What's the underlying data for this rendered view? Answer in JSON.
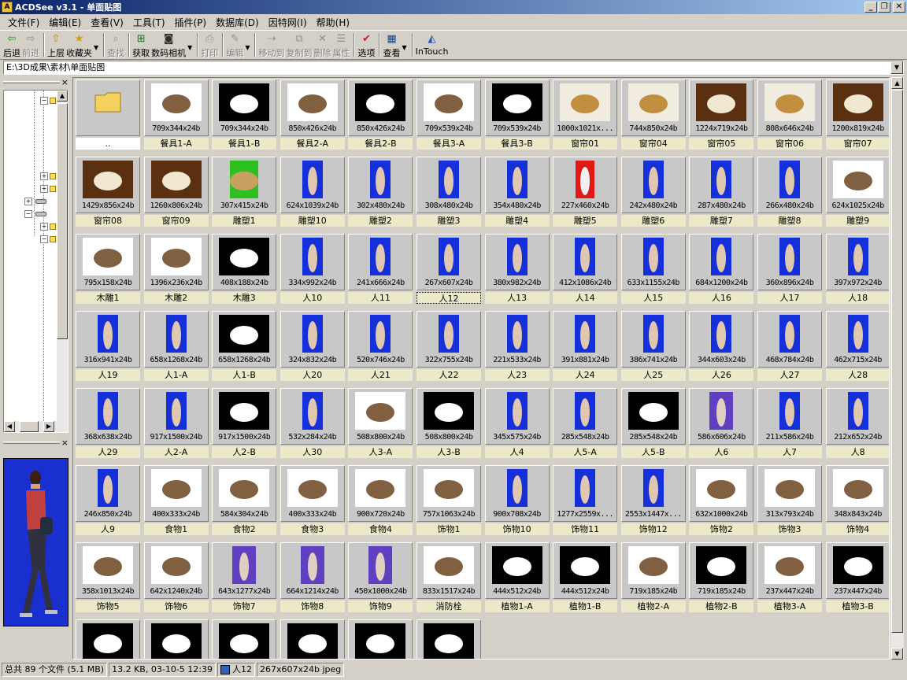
{
  "window": {
    "title": "ACDSee v3.1 - 单面贴图"
  },
  "menu": [
    "文件(F)",
    "编辑(E)",
    "查看(V)",
    "工具(T)",
    "插件(P)",
    "数据库(D)",
    "因特网(I)",
    "帮助(H)"
  ],
  "toolbar": [
    {
      "label": "后退",
      "icon": "back-icon",
      "enabled": true
    },
    {
      "label": "前进",
      "icon": "forward-icon",
      "enabled": false
    },
    {
      "label": "上层",
      "icon": "up-folder-icon",
      "enabled": true
    },
    {
      "label": "收藏夹",
      "icon": "favorites-icon",
      "enabled": true
    },
    {
      "label": "查找",
      "icon": "find-icon",
      "enabled": false
    },
    {
      "label": "获取",
      "icon": "acquire-icon",
      "enabled": true
    },
    {
      "label": "数码相机",
      "icon": "camera-icon",
      "enabled": true
    },
    {
      "label": "打印",
      "icon": "print-icon",
      "enabled": false
    },
    {
      "label": "编辑",
      "icon": "edit-icon",
      "enabled": false
    },
    {
      "label": "移动到",
      "icon": "move-icon",
      "enabled": false
    },
    {
      "label": "复制到",
      "icon": "copy-icon",
      "enabled": false
    },
    {
      "label": "删除",
      "icon": "delete-icon",
      "enabled": false
    },
    {
      "label": "属性",
      "icon": "properties-icon",
      "enabled": false
    },
    {
      "label": "选项",
      "icon": "options-icon",
      "enabled": true
    },
    {
      "label": "查看",
      "icon": "view-icon",
      "enabled": true
    },
    {
      "label": "InTouch",
      "icon": "intouch-icon",
      "enabled": true
    }
  ],
  "address": "E:\\3D成果\\素材\\单面贴图",
  "files": [
    {
      "name": "..",
      "dims": "",
      "kind": "folder"
    },
    {
      "name": "餐具1-A",
      "dims": "709x344x24b",
      "kind": "white"
    },
    {
      "name": "餐具1-B",
      "dims": "709x344x24b",
      "kind": "black"
    },
    {
      "name": "餐具2-A",
      "dims": "850x426x24b",
      "kind": "white"
    },
    {
      "name": "餐具2-B",
      "dims": "850x426x24b",
      "kind": "black"
    },
    {
      "name": "餐具3-A",
      "dims": "709x539x24b",
      "kind": "white"
    },
    {
      "name": "餐具3-B",
      "dims": "709x539x24b",
      "kind": "black"
    },
    {
      "name": "窗帘01",
      "dims": "1000x1021x...",
      "kind": "cream"
    },
    {
      "name": "窗帘04",
      "dims": "744x850x24b",
      "kind": "cream"
    },
    {
      "name": "窗帘05",
      "dims": "1224x719x24b",
      "kind": "brown"
    },
    {
      "name": "窗帘06",
      "dims": "808x646x24b",
      "kind": "cream"
    },
    {
      "name": "窗帘07",
      "dims": "1200x819x24b",
      "kind": "brown"
    },
    {
      "name": "窗帘08",
      "dims": "1429x856x24b",
      "kind": "brown"
    },
    {
      "name": "窗帘09",
      "dims": "1260x806x24b",
      "kind": "brown"
    },
    {
      "name": "雕塑1",
      "dims": "307x415x24b",
      "kind": "green"
    },
    {
      "name": "雕塑10",
      "dims": "624x1039x24b",
      "kind": "blue"
    },
    {
      "name": "雕塑2",
      "dims": "302x480x24b",
      "kind": "blue"
    },
    {
      "name": "雕塑3",
      "dims": "308x480x24b",
      "kind": "blue"
    },
    {
      "name": "雕塑4",
      "dims": "354x480x24b",
      "kind": "blue"
    },
    {
      "name": "雕塑5",
      "dims": "227x460x24b",
      "kind": "red"
    },
    {
      "name": "雕塑6",
      "dims": "242x480x24b",
      "kind": "blue"
    },
    {
      "name": "雕塑7",
      "dims": "287x480x24b",
      "kind": "blue"
    },
    {
      "name": "雕塑8",
      "dims": "266x480x24b",
      "kind": "blue"
    },
    {
      "name": "雕塑9",
      "dims": "624x1025x24b",
      "kind": "white"
    },
    {
      "name": "木雕1",
      "dims": "795x158x24b",
      "kind": "white"
    },
    {
      "name": "木雕2",
      "dims": "1396x236x24b",
      "kind": "white"
    },
    {
      "name": "木雕3",
      "dims": "408x188x24b",
      "kind": "black"
    },
    {
      "name": "人10",
      "dims": "334x992x24b",
      "kind": "blue"
    },
    {
      "name": "人11",
      "dims": "241x666x24b",
      "kind": "blue"
    },
    {
      "name": "人12",
      "dims": "267x607x24b",
      "kind": "blue"
    },
    {
      "name": "人13",
      "dims": "380x982x24b",
      "kind": "blue"
    },
    {
      "name": "人14",
      "dims": "412x1086x24b",
      "kind": "blue"
    },
    {
      "name": "人15",
      "dims": "633x1155x24b",
      "kind": "blue"
    },
    {
      "name": "人16",
      "dims": "684x1200x24b",
      "kind": "blue"
    },
    {
      "name": "人17",
      "dims": "360x896x24b",
      "kind": "blue"
    },
    {
      "name": "人18",
      "dims": "397x972x24b",
      "kind": "blue"
    },
    {
      "name": "人19",
      "dims": "316x941x24b",
      "kind": "blue"
    },
    {
      "name": "人1-A",
      "dims": "658x1268x24b",
      "kind": "blue"
    },
    {
      "name": "人1-B",
      "dims": "658x1268x24b",
      "kind": "black"
    },
    {
      "name": "人20",
      "dims": "324x832x24b",
      "kind": "blue"
    },
    {
      "name": "人21",
      "dims": "520x746x24b",
      "kind": "blue"
    },
    {
      "name": "人22",
      "dims": "322x755x24b",
      "kind": "blue"
    },
    {
      "name": "人23",
      "dims": "221x533x24b",
      "kind": "blue"
    },
    {
      "name": "人24",
      "dims": "391x881x24b",
      "kind": "blue"
    },
    {
      "name": "人25",
      "dims": "386x741x24b",
      "kind": "blue"
    },
    {
      "name": "人26",
      "dims": "344x603x24b",
      "kind": "blue"
    },
    {
      "name": "人27",
      "dims": "468x784x24b",
      "kind": "blue"
    },
    {
      "name": "人28",
      "dims": "462x715x24b",
      "kind": "blue"
    },
    {
      "name": "人29",
      "dims": "368x638x24b",
      "kind": "blue"
    },
    {
      "name": "人2-A",
      "dims": "917x1500x24b",
      "kind": "blue"
    },
    {
      "name": "人2-B",
      "dims": "917x1500x24b",
      "kind": "black"
    },
    {
      "name": "人30",
      "dims": "532x284x24b",
      "kind": "blue"
    },
    {
      "name": "人3-A",
      "dims": "508x800x24b",
      "kind": "white"
    },
    {
      "name": "人3-B",
      "dims": "508x800x24b",
      "kind": "black"
    },
    {
      "name": "人4",
      "dims": "345x575x24b",
      "kind": "blue"
    },
    {
      "name": "人5-A",
      "dims": "285x548x24b",
      "kind": "blue"
    },
    {
      "name": "人5-B",
      "dims": "285x548x24b",
      "kind": "black"
    },
    {
      "name": "人6",
      "dims": "586x606x24b",
      "kind": "purple"
    },
    {
      "name": "人7",
      "dims": "211x586x24b",
      "kind": "blue"
    },
    {
      "name": "人8",
      "dims": "212x652x24b",
      "kind": "blue"
    },
    {
      "name": "人9",
      "dims": "246x850x24b",
      "kind": "blue"
    },
    {
      "name": "食物1",
      "dims": "400x333x24b",
      "kind": "white"
    },
    {
      "name": "食物2",
      "dims": "584x304x24b",
      "kind": "white"
    },
    {
      "name": "食物3",
      "dims": "400x333x24b",
      "kind": "white"
    },
    {
      "name": "食物4",
      "dims": "900x720x24b",
      "kind": "white"
    },
    {
      "name": "饰物1",
      "dims": "757x1063x24b",
      "kind": "white"
    },
    {
      "name": "饰物10",
      "dims": "900x708x24b",
      "kind": "blue"
    },
    {
      "name": "饰物11",
      "dims": "1277x2559x...",
      "kind": "blue"
    },
    {
      "name": "饰物12",
      "dims": "2553x1447x...",
      "kind": "blue"
    },
    {
      "name": "饰物2",
      "dims": "632x1000x24b",
      "kind": "white"
    },
    {
      "name": "饰物3",
      "dims": "313x793x24b",
      "kind": "white"
    },
    {
      "name": "饰物4",
      "dims": "348x843x24b",
      "kind": "white"
    },
    {
      "name": "饰物5",
      "dims": "358x1013x24b",
      "kind": "white"
    },
    {
      "name": "饰物6",
      "dims": "642x1240x24b",
      "kind": "white"
    },
    {
      "name": "饰物7",
      "dims": "643x1277x24b",
      "kind": "purple"
    },
    {
      "name": "饰物8",
      "dims": "664x1214x24b",
      "kind": "purple"
    },
    {
      "name": "饰物9",
      "dims": "450x1000x24b",
      "kind": "purple"
    },
    {
      "name": "消防栓",
      "dims": "833x1517x24b",
      "kind": "white"
    },
    {
      "name": "植物1-A",
      "dims": "444x512x24b",
      "kind": "black"
    },
    {
      "name": "植物1-B",
      "dims": "444x512x24b",
      "kind": "black"
    },
    {
      "name": "植物2-A",
      "dims": "719x185x24b",
      "kind": "white"
    },
    {
      "name": "植物2-B",
      "dims": "719x185x24b",
      "kind": "black"
    },
    {
      "name": "植物3-A",
      "dims": "237x447x24b",
      "kind": "white"
    },
    {
      "name": "植物3-B",
      "dims": "237x447x24b",
      "kind": "black"
    },
    {
      "name": "",
      "dims": "",
      "kind": "black"
    },
    {
      "name": "",
      "dims": "",
      "kind": "black"
    },
    {
      "name": "",
      "dims": "",
      "kind": "black"
    },
    {
      "name": "",
      "dims": "",
      "kind": "black"
    },
    {
      "name": "",
      "dims": "",
      "kind": "black"
    },
    {
      "name": "",
      "dims": "",
      "kind": "black"
    }
  ],
  "selected_file": "人12",
  "status": {
    "total": "总共 89 个文件 (5.1 MB)",
    "info": "13.2 KB, 03-10-5 12:39",
    "name": "人12",
    "format": "267x607x24b jpeg"
  },
  "colors": {
    "title_start": "#0a246a",
    "title_end": "#a6caf0",
    "label_bg": "#ece9c8",
    "blue_bg": "#1530d8"
  }
}
